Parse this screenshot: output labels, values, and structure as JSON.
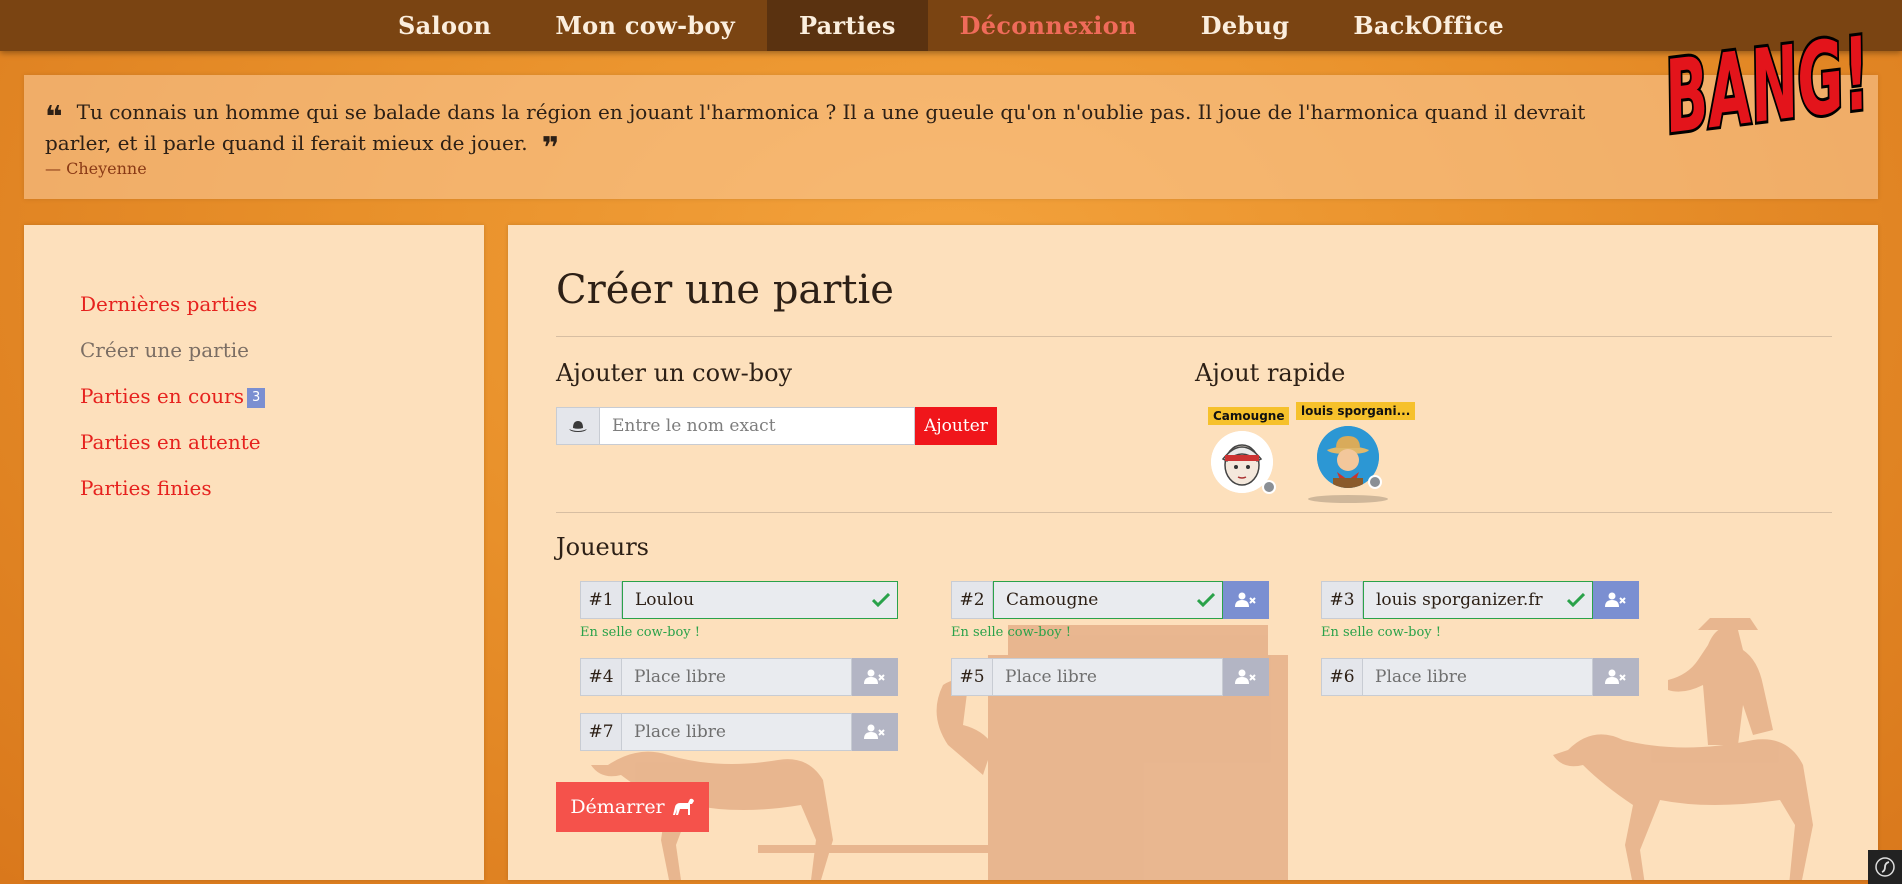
{
  "nav": {
    "items": [
      {
        "label": "Saloon"
      },
      {
        "label": "Mon cow-boy"
      },
      {
        "label": "Parties"
      },
      {
        "label": "Déconnexion"
      },
      {
        "label": "Debug"
      },
      {
        "label": "BackOffice"
      }
    ]
  },
  "logo": {
    "text": "BANG!"
  },
  "quote": {
    "text": "Tu connais un homme qui se balade dans la région en jouant l'harmonica ? Il a une gueule qu'on n'oublie pas. Il joue de l'harmonica quand il devrait parler, et il parle quand il ferait mieux de jouer.",
    "author": "— Cheyenne"
  },
  "sidebar": {
    "items": [
      {
        "label": "Dernières parties"
      },
      {
        "label": "Créer une partie"
      },
      {
        "label": "Parties en cours",
        "badge": "3"
      },
      {
        "label": "Parties en attente"
      },
      {
        "label": "Parties finies"
      }
    ]
  },
  "main": {
    "title": "Créer une partie",
    "add": {
      "title": "Ajouter un cow-boy",
      "placeholder": "Entre le nom exact",
      "button": "Ajouter"
    },
    "quick": {
      "title": "Ajout rapide",
      "players": [
        {
          "name": "Camougne"
        },
        {
          "name": "louis sporgani..."
        }
      ]
    },
    "players": {
      "title": "Joueurs",
      "helper": "En selle cow-boy !",
      "placeholder": "Place libre",
      "slots": [
        {
          "num": "#1",
          "value": "Loulou"
        },
        {
          "num": "#2",
          "value": "Camougne"
        },
        {
          "num": "#3",
          "value": "louis sporganizer.fr"
        },
        {
          "num": "#4",
          "value": ""
        },
        {
          "num": "#5",
          "value": ""
        },
        {
          "num": "#6",
          "value": ""
        },
        {
          "num": "#7",
          "value": ""
        }
      ]
    },
    "start": "Démarrer"
  },
  "colors": {
    "nav_bg": "#7a4412",
    "accent_red": "#f0161b",
    "success": "#2aa24a",
    "badge": "#7b8fd1",
    "panel": "#fde0bc"
  }
}
